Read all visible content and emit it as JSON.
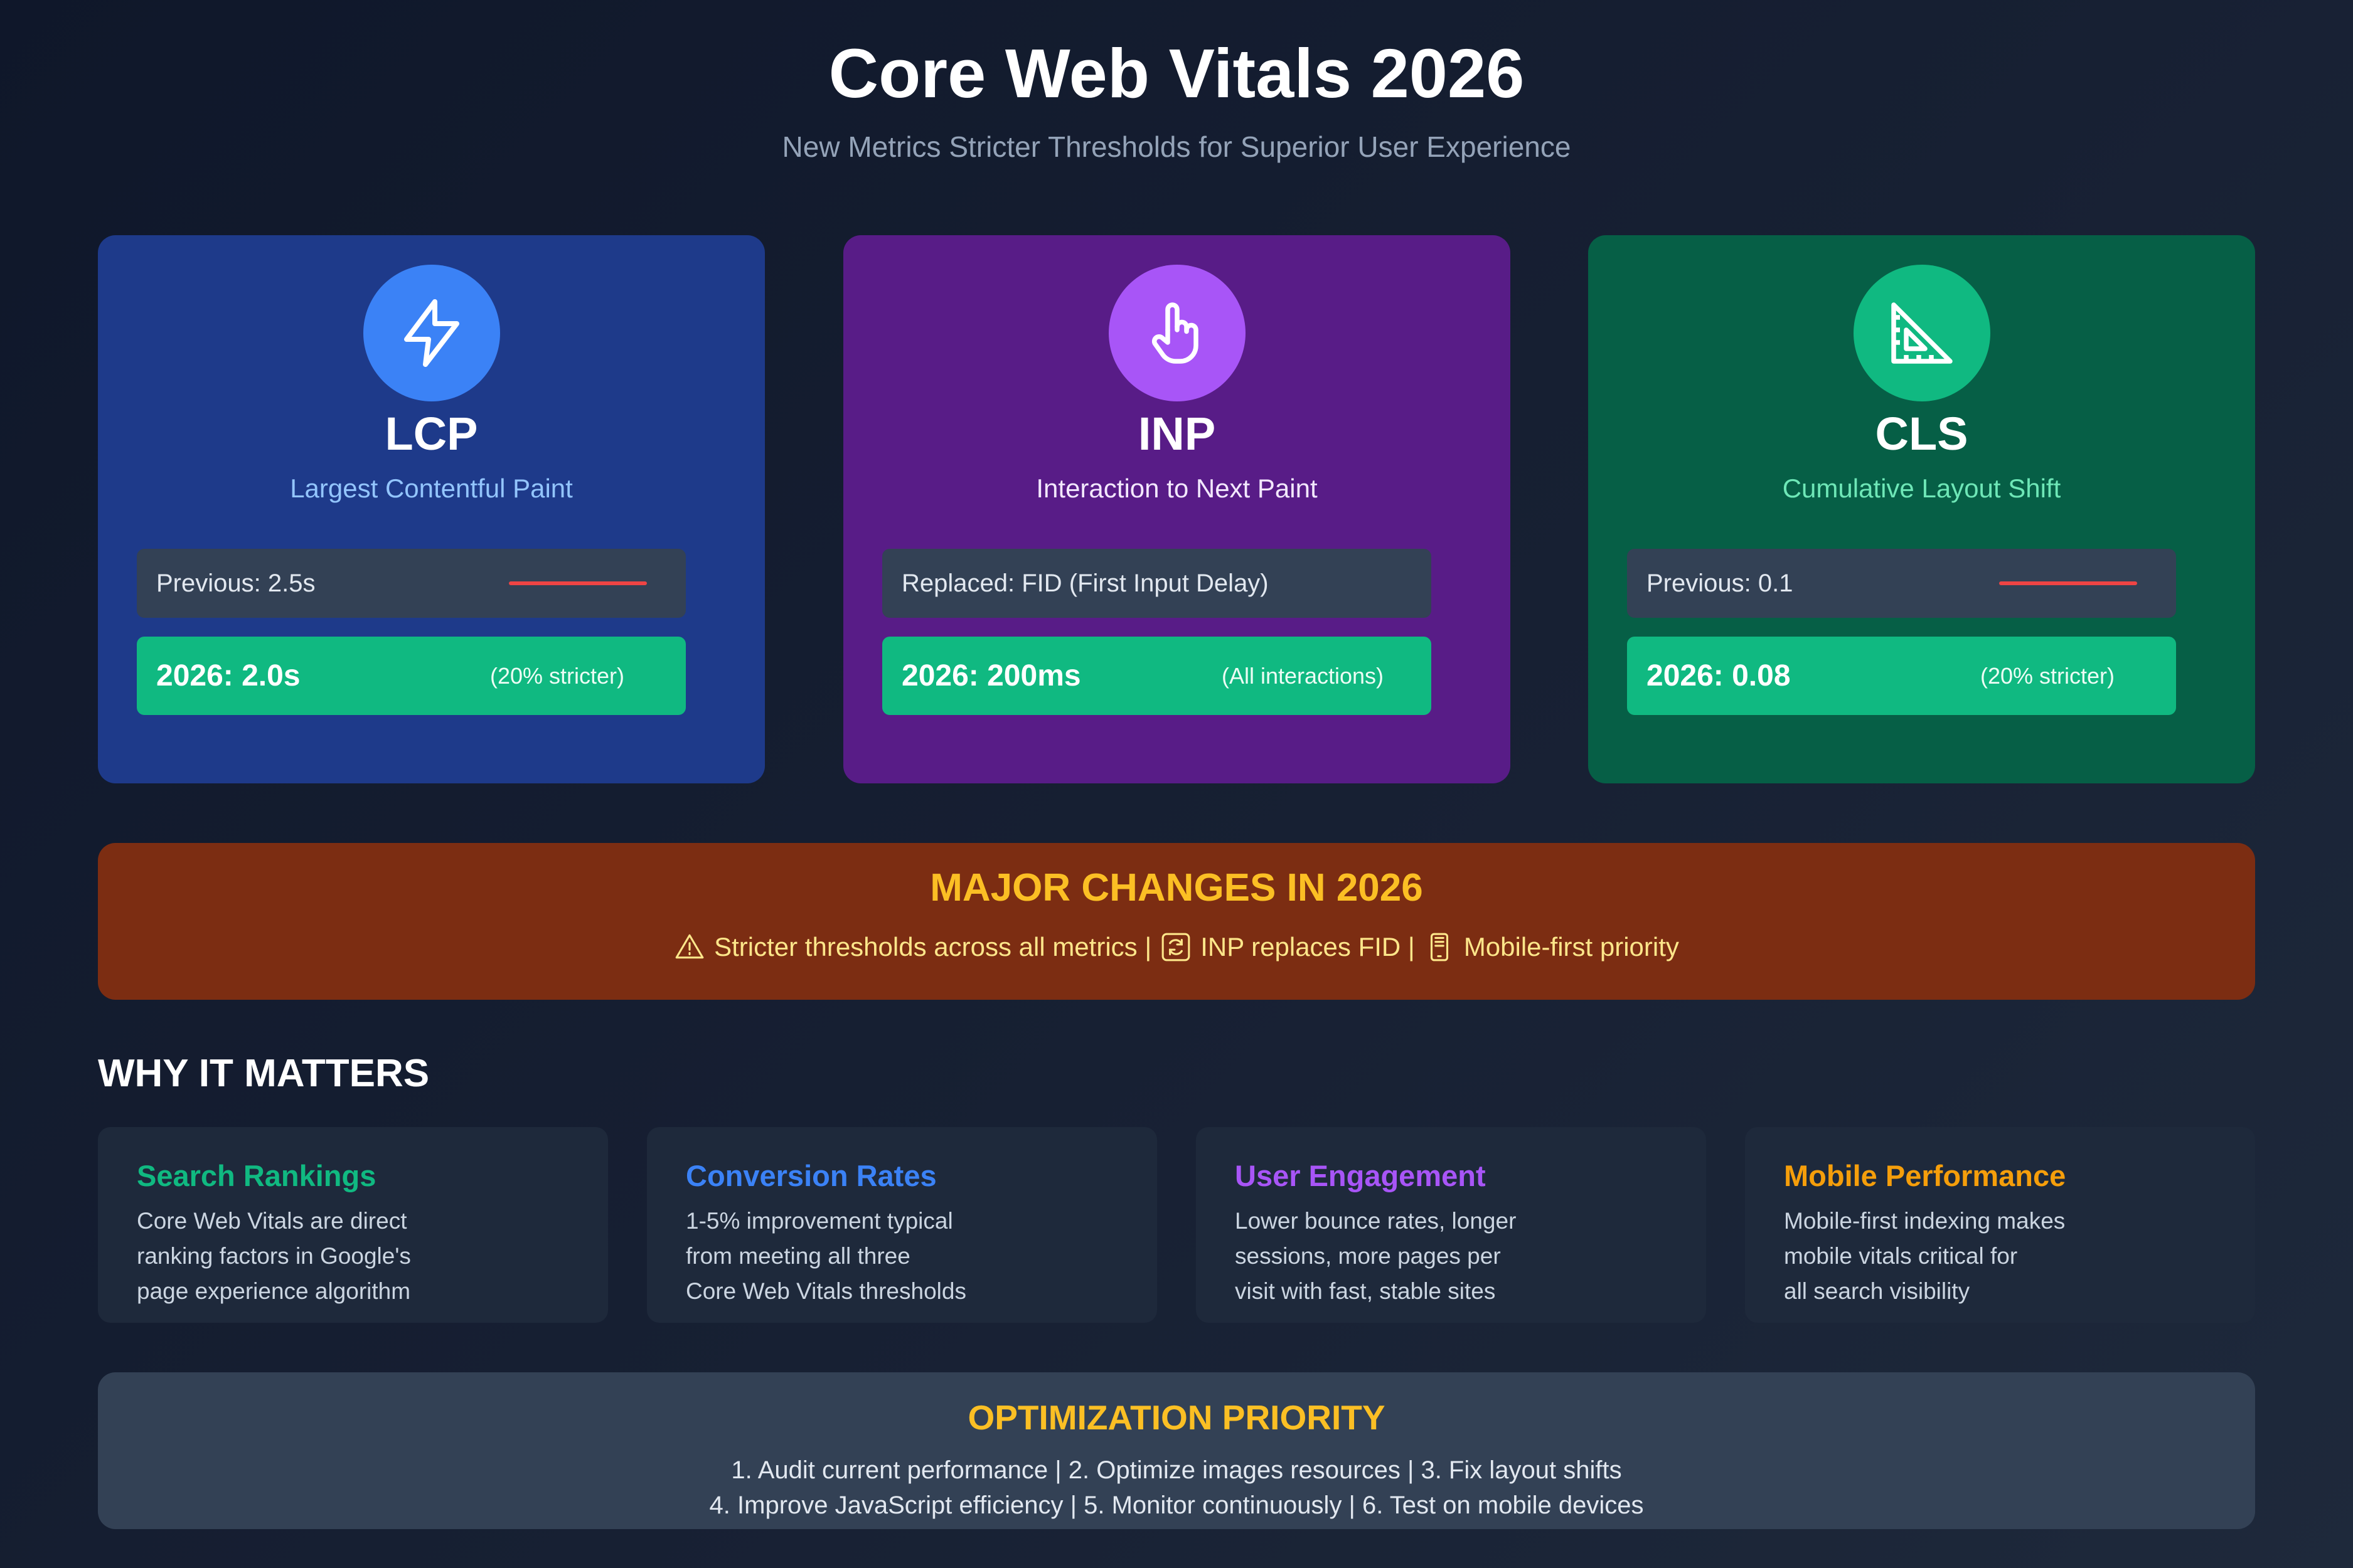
{
  "header": {
    "title": "Core Web Vitals 2026",
    "subtitle": "New Metrics Stricter Thresholds for Superior User Experience"
  },
  "metrics": [
    {
      "abbr": "LCP",
      "full_name": "Largest Contentful Paint",
      "previous": "Previous: 2.5s",
      "new_value": "2026: 2.0s",
      "note": "(20% stricter)",
      "icon": "lightning-icon",
      "card_color": "#1e3a8a",
      "icon_color": "#3b82f6",
      "name_color": "#93c5fd"
    },
    {
      "abbr": "INP",
      "full_name": "Interaction to Next Paint",
      "previous": "Replaced: FID (First Input Delay)",
      "new_value": "2026: 200ms",
      "note": "(All interactions)",
      "icon": "pointer-hand-icon",
      "card_color": "#581c87",
      "icon_color": "#a855f7",
      "name_color": "#f3e8ff"
    },
    {
      "abbr": "CLS",
      "full_name": "Cumulative Layout Shift",
      "previous": "Previous: 0.1",
      "new_value": "2026: 0.08",
      "note": "(20% stricter)",
      "icon": "ruler-triangle-icon",
      "card_color": "#065f46",
      "icon_color": "#10b981",
      "name_color": "#6ee7b7"
    }
  ],
  "changes": {
    "title": "MAJOR CHANGES IN 2026",
    "item1": "Stricter thresholds across all metrics |",
    "item2": "INP replaces FID |",
    "item3": "Mobile-first priority",
    "icons": [
      "warning-icon",
      "refresh-icon",
      "mobile-icon"
    ]
  },
  "why": {
    "heading": "WHY IT MATTERS",
    "cards": [
      {
        "title": "Search Rankings",
        "desc": "Core Web Vitals are direct\nranking factors in Google's\npage experience algorithm",
        "color": "#10b981"
      },
      {
        "title": "Conversion Rates",
        "desc": "1-5% improvement typical\nfrom meeting all three\nCore Web Vitals thresholds",
        "color": "#3b82f6"
      },
      {
        "title": "User Engagement",
        "desc": "Lower bounce rates, longer\nsessions, more pages per\nvisit with fast, stable sites",
        "color": "#a855f7"
      },
      {
        "title": "Mobile Performance",
        "desc": "Mobile-first indexing makes\nmobile vitals critical for\nall search visibility",
        "color": "#f59e0b"
      }
    ]
  },
  "optimization": {
    "title": "OPTIMIZATION PRIORITY",
    "line1": "1. Audit current performance | 2. Optimize images resources | 3. Fix layout shifts",
    "line2": "4. Improve JavaScript efficiency | 5. Monitor continuously | 6. Test on mobile devices"
  }
}
